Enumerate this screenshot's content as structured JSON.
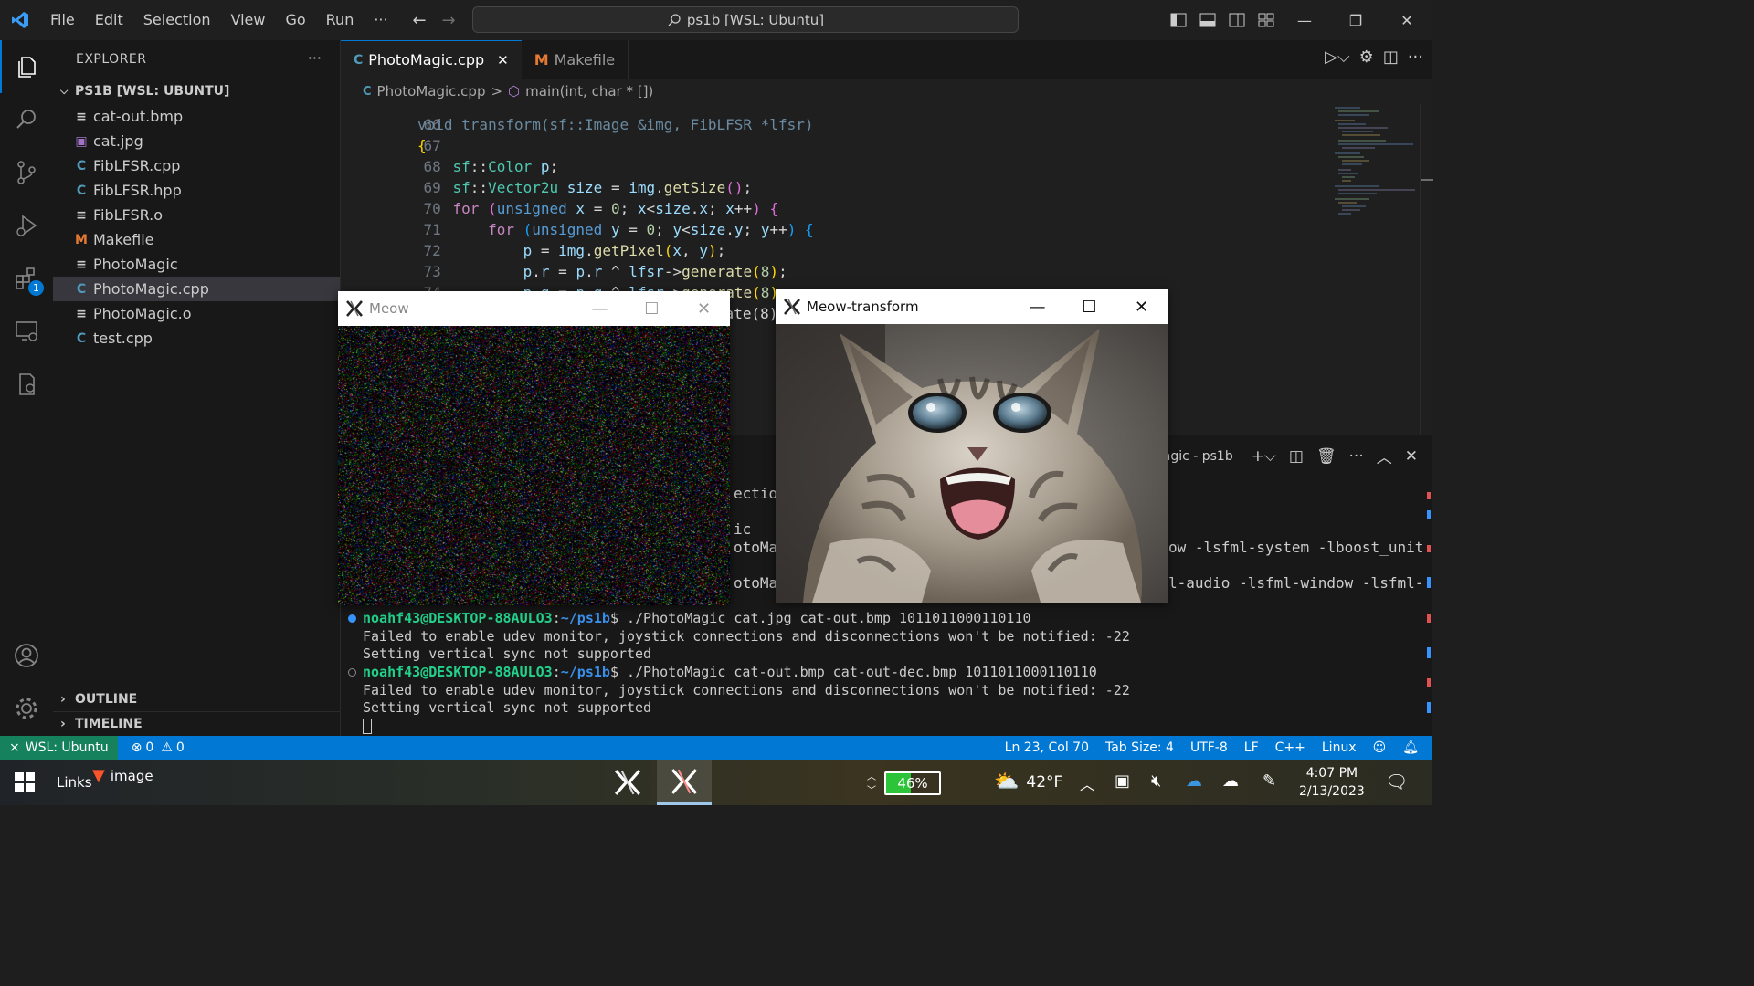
{
  "titlebar": {
    "menus": [
      "File",
      "Edit",
      "Selection",
      "View",
      "Go",
      "Run",
      "···"
    ],
    "command_center": "ps1b [WSL: Ubuntu]"
  },
  "sidebar": {
    "header": "EXPLORER",
    "more": "···",
    "workspace": "PS1B [WSL: UBUNTU]",
    "files": [
      {
        "name": "cat-out.bmp",
        "icon": "text-file-icon"
      },
      {
        "name": "cat.jpg",
        "icon": "image-file-icon"
      },
      {
        "name": "FibLFSR.cpp",
        "icon": "cpp-file-icon"
      },
      {
        "name": "FibLFSR.hpp",
        "icon": "cpp-file-icon"
      },
      {
        "name": "FibLFSR.o",
        "icon": "text-file-icon"
      },
      {
        "name": "Makefile",
        "icon": "makefile-icon"
      },
      {
        "name": "PhotoMagic",
        "icon": "text-file-icon"
      },
      {
        "name": "PhotoMagic.cpp",
        "icon": "cpp-file-icon",
        "selected": true
      },
      {
        "name": "PhotoMagic.o",
        "icon": "text-file-icon"
      },
      {
        "name": "test.cpp",
        "icon": "cpp-file-icon"
      }
    ],
    "outline": "OUTLINE",
    "timeline": "TIMELINE"
  },
  "activity_badge": "1",
  "editor": {
    "tabs": [
      {
        "label": "PhotoMagic.cpp",
        "active": true,
        "close": "✕"
      },
      {
        "label": "Makefile",
        "active": false
      }
    ],
    "breadcrumb": {
      "file": "PhotoMagic.cpp",
      "separator": ">",
      "symbol": "main(int, char * [])"
    },
    "line_numbers": [
      "66",
      "67",
      "68",
      "69",
      "70",
      "71",
      "72",
      "73",
      "74"
    ],
    "partial_top_line": "void transform(sf::Image &img, FibLFSR *lfsr)",
    "partial_line_75": "p.b = p.b ^ lfsr->generate(8);"
  },
  "terminal": {
    "header_fragment": "agic - ps1b",
    "fragments": [
      "ection",
      "ic",
      "otoMag",
      "otoMag",
      "ow -lsfml-system -lboost_unit",
      "l-audio -lsfml-window -lsfml-"
    ],
    "lines": [
      {
        "user": "noahf43@DESKTOP-88AULO3",
        "path": "~/ps1b",
        "cmd": "$ ./PhotoMagic cat.jpg cat-out.bmp 1011011000110110"
      },
      {
        "text": "Failed to enable udev monitor, joystick connections and disconnections won't be notified: -22"
      },
      {
        "text": "Setting vertical sync not supported"
      },
      {
        "user": "noahf43@DESKTOP-88AULO3",
        "path": "~/ps1b",
        "cmd": "$ ./PhotoMagic cat-out.bmp cat-out-dec.bmp 1011011000110110"
      },
      {
        "text": "Failed to enable udev monitor, joystick connections and disconnections won't be notified: -22"
      },
      {
        "text": "Setting vertical sync not supported"
      }
    ]
  },
  "windows": {
    "meow": {
      "title": "Meow"
    },
    "meow_transform": {
      "title": "Meow-transform"
    }
  },
  "statusbar": {
    "remote": "WSL: Ubuntu",
    "errors": "0",
    "warnings": "0",
    "position": "Ln 23, Col 70",
    "tab_size": "Tab Size: 4",
    "encoding": "UTF-8",
    "eol": "LF",
    "language": "C++",
    "os": "Linux"
  },
  "taskbar": {
    "links": "Links",
    "brave_label": "image",
    "battery": "46%",
    "battery_level": 0.46,
    "weather": "42°F",
    "time": "4:07 PM",
    "date": "2/13/2023"
  },
  "colors": {
    "accent": "#0078d4",
    "remote": "#16825d",
    "makefile": "#e37933",
    "cpp": "#519aba",
    "image": "#a074c4"
  }
}
